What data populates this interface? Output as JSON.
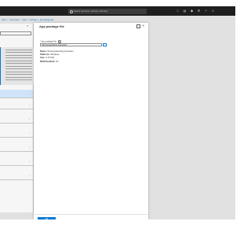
{
  "search": {
    "placeholder": "Search resources, services, and docs"
  },
  "breadcrumb": {
    "items": [
      "Home",
      "Client apps",
      "Apps",
      "Add app",
      "App package file"
    ],
    "separator": ">"
  },
  "left_panel": {
    "close_glyph": "✕"
  },
  "panel": {
    "title": "App package file",
    "close_glyph": "✕",
    "field_label": "App package file",
    "required_marker": "*",
    "file_value": "\"Wrmsnetworking.intunewin\"",
    "details": [
      {
        "key": "Name:",
        "value": "Wrmsnetworking.intunewin"
      },
      {
        "key": "Platform:",
        "value": "Windows"
      },
      {
        "key": "Size:",
        "value": "4.76 KiB"
      },
      {
        "key": "MAM Enabled:",
        "value": "No"
      }
    ],
    "ok_label": "OK"
  },
  "icons": {
    "search": "search-icon",
    "browse": "folder-icon",
    "close": "close-icon",
    "maximize": "maximize-icon",
    "chevron": "chevron-right-icon"
  },
  "colors": {
    "accent": "#0078d4",
    "topbar": "#1f1f1f",
    "background": "#e1e1e1"
  }
}
